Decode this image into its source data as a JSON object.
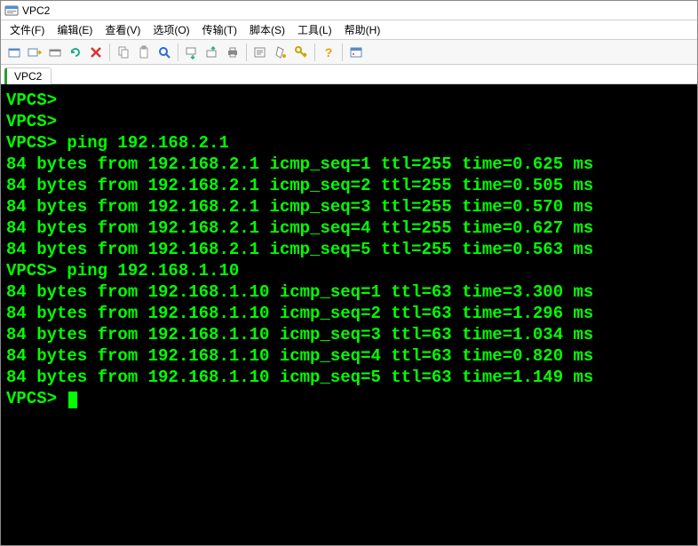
{
  "window": {
    "title": "VPC2"
  },
  "menu": {
    "file": "文件(F)",
    "edit": "编辑(E)",
    "view": "查看(V)",
    "options": "选项(O)",
    "transfer": "传输(T)",
    "scripts": "脚本(S)",
    "tools": "工具(L)",
    "help": "帮助(H)"
  },
  "toolbar_icons": {
    "session": "session-icon",
    "quick": "quick-connect-icon",
    "reconnect": "reconnect-icon",
    "disconnect": "disconnect-icon",
    "cancel": "cancel-icon",
    "copy": "copy-icon",
    "paste": "paste-icon",
    "find": "find-icon",
    "transfer1": "transfer-down-icon",
    "transfer2": "transfer-up-icon",
    "print": "print-icon",
    "options": "options-icon",
    "wand": "wand-icon",
    "key": "key-icon",
    "help": "help-icon",
    "about": "about-icon"
  },
  "tabs": {
    "active": "VPC2"
  },
  "terminal": {
    "prompt": "VPCS>",
    "sessions": [
      {
        "command": "",
        "responses": []
      },
      {
        "command": "",
        "responses": []
      },
      {
        "command": "ping 192.168.2.1",
        "responses": [
          "84 bytes from 192.168.2.1 icmp_seq=1 ttl=255 time=0.625 ms",
          "84 bytes from 192.168.2.1 icmp_seq=2 ttl=255 time=0.505 ms",
          "84 bytes from 192.168.2.1 icmp_seq=3 ttl=255 time=0.570 ms",
          "84 bytes from 192.168.2.1 icmp_seq=4 ttl=255 time=0.627 ms",
          "84 bytes from 192.168.2.1 icmp_seq=5 ttl=255 time=0.563 ms"
        ]
      },
      {
        "command": "ping 192.168.1.10",
        "responses": [
          "84 bytes from 192.168.1.10 icmp_seq=1 ttl=63 time=3.300 ms",
          "84 bytes from 192.168.1.10 icmp_seq=2 ttl=63 time=1.296 ms",
          "84 bytes from 192.168.1.10 icmp_seq=3 ttl=63 time=1.034 ms",
          "84 bytes from 192.168.1.10 icmp_seq=4 ttl=63 time=0.820 ms",
          "84 bytes from 192.168.1.10 icmp_seq=5 ttl=63 time=1.149 ms"
        ]
      },
      {
        "command": "",
        "responses": []
      }
    ]
  }
}
